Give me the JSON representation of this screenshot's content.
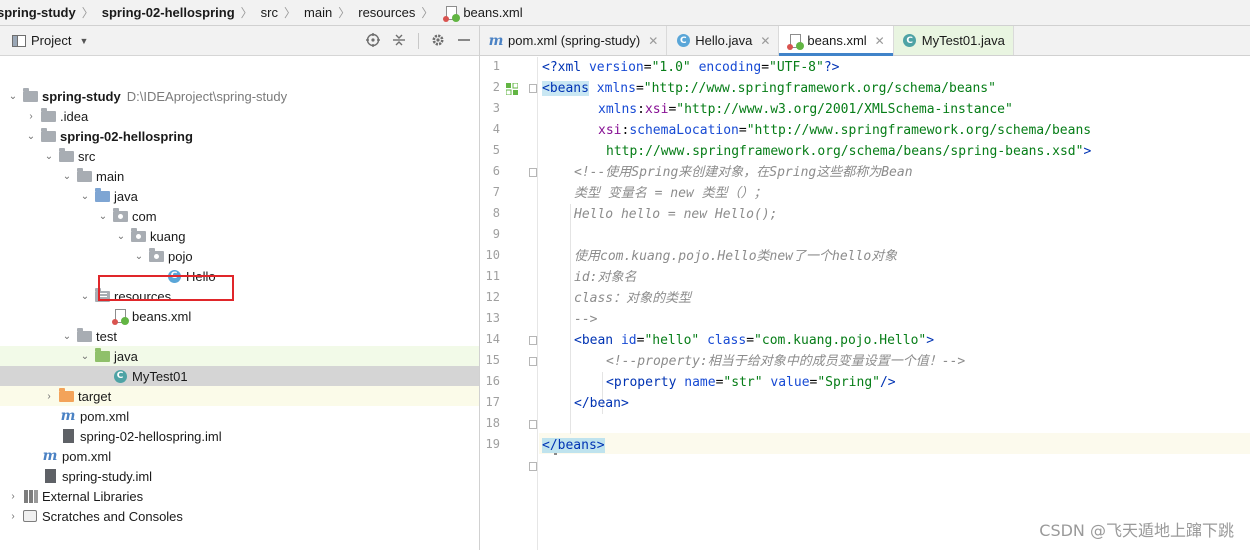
{
  "breadcrumb": {
    "items": [
      "spring-study",
      "spring-02-hellospring",
      "src",
      "main",
      "resources",
      "beans.xml"
    ]
  },
  "project_panel": {
    "title": "Project",
    "actions": [
      "target-icon",
      "collapse-icon",
      "gear-icon",
      "minimize-icon"
    ],
    "tree": [
      {
        "label": "spring-study",
        "path": "D:\\IDEAproject\\spring-study"
      },
      {
        "label": ".idea"
      },
      {
        "label": "spring-02-hellospring"
      },
      {
        "label": "src"
      },
      {
        "label": "main"
      },
      {
        "label": "java"
      },
      {
        "label": "com"
      },
      {
        "label": "kuang"
      },
      {
        "label": "pojo"
      },
      {
        "label": "Hello"
      },
      {
        "label": "resources"
      },
      {
        "label": "beans.xml"
      },
      {
        "label": "test"
      },
      {
        "label": "java"
      },
      {
        "label": "MyTest01"
      },
      {
        "label": "target"
      },
      {
        "label": "pom.xml"
      },
      {
        "label": "spring-02-hellospring.iml"
      },
      {
        "label": "pom.xml"
      },
      {
        "label": "spring-study.iml"
      },
      {
        "label": "External Libraries"
      },
      {
        "label": "Scratches and Consoles"
      }
    ]
  },
  "editor": {
    "tabs": [
      {
        "label": "pom.xml (spring-study)",
        "icon": "maven-icon"
      },
      {
        "label": "Hello.java",
        "icon": "class-icon"
      },
      {
        "label": "beans.xml",
        "icon": "xml-file-icon",
        "active": true
      },
      {
        "label": "MyTest01.java",
        "icon": "test-class-icon"
      }
    ],
    "line_numbers": [
      "1",
      "2",
      "3",
      "4",
      "5",
      "6",
      "7",
      "8",
      "9",
      "10",
      "11",
      "12",
      "13",
      "14",
      "15",
      "16",
      "17",
      "18",
      "19"
    ],
    "code": {
      "l1": [
        "<?",
        "xml ",
        "version",
        "=",
        "\"1.0\"",
        " ",
        "encoding",
        "=",
        "\"UTF-8\"",
        "?>"
      ],
      "l2": [
        "<",
        "beans",
        " ",
        "xmlns",
        "=",
        "\"http://www.springframework.org/schema/beans\""
      ],
      "l3": [
        "xmlns",
        ":",
        "xsi",
        "=",
        "\"http://www.w3.org/2001/XMLSchema-instance\""
      ],
      "l4": [
        "xsi",
        ":",
        "schemaLocation",
        "=",
        "\"http://www.springframework.org/schema/beans"
      ],
      "l5": [
        "http://www.springframework.org/schema/beans/spring-beans.xsd\"",
        ">"
      ],
      "l6": "<!--使用Spring来创建对象，在Spring这些都称为Bean",
      "l7": "类型 变量名 = new 类型（）；",
      "l8": "Hello hello = new Hello();",
      "l9": "",
      "l10": "使用com.kuang.pojo.Hello类new了一个hello对象",
      "l11": "id:对象名",
      "l12": "class：对象的类型",
      "l13": "-->",
      "l14": [
        "<",
        "bean ",
        "id",
        "=",
        "\"hello\"",
        " ",
        "class",
        "=",
        "\"com.kuang.pojo.Hello\"",
        ">"
      ],
      "l15": "<!--property:相当于给对象中的成员变量设置一个值！-->",
      "l16": [
        "<",
        "property ",
        "name",
        "=",
        "\"str\"",
        " ",
        "value",
        "=",
        "\"Spring\"",
        "/>"
      ],
      "l17": [
        "</",
        "bean",
        ">"
      ],
      "l18": "",
      "l19": [
        "</",
        "beans",
        ">"
      ]
    }
  },
  "watermark": "CSDN @飞天遁地上蹿下跳"
}
